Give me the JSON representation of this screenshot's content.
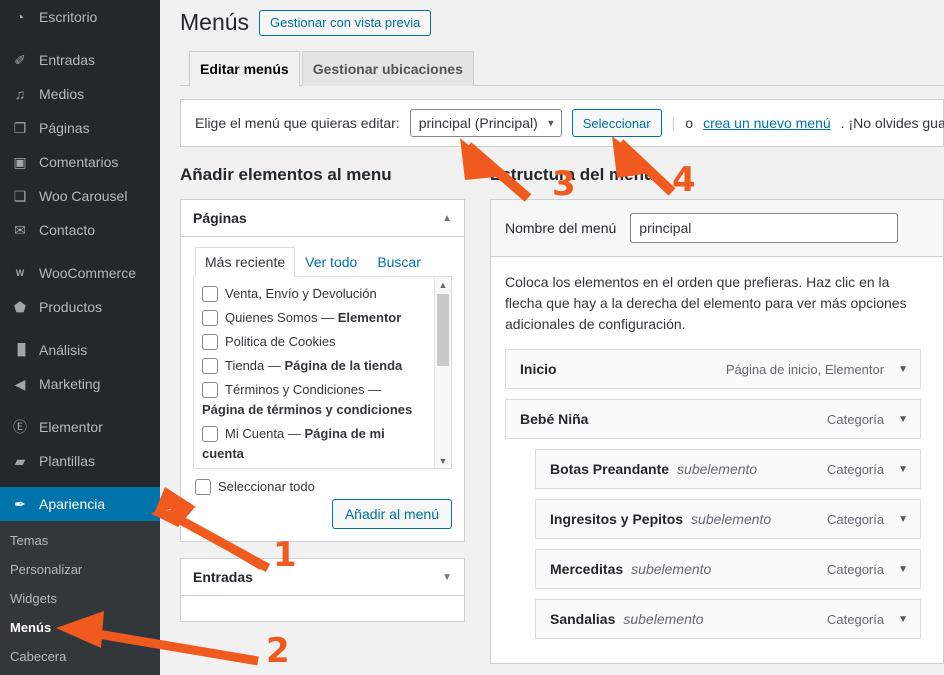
{
  "sidebar": {
    "items": [
      {
        "label": "Escritorio",
        "icon": "dashboard-icon",
        "current": false
      },
      {
        "label": "Entradas",
        "icon": "pin-icon",
        "current": false
      },
      {
        "label": "Medios",
        "icon": "media-icon",
        "current": false
      },
      {
        "label": "Páginas",
        "icon": "pages-icon",
        "current": false
      },
      {
        "label": "Comentarios",
        "icon": "comments-icon",
        "current": false
      },
      {
        "label": "Woo Carousel",
        "icon": "gallery-icon",
        "current": false
      },
      {
        "label": "Contacto",
        "icon": "envelope-icon",
        "current": false
      },
      {
        "label": "WooCommerce",
        "icon": "woo-icon",
        "current": false
      },
      {
        "label": "Productos",
        "icon": "box-icon",
        "current": false
      },
      {
        "label": "Análisis",
        "icon": "chart-bars-icon",
        "current": false
      },
      {
        "label": "Marketing",
        "icon": "megaphone-icon",
        "current": false
      },
      {
        "label": "Elementor",
        "icon": "elementor-icon",
        "current": false
      },
      {
        "label": "Plantillas",
        "icon": "folder-icon",
        "current": false
      },
      {
        "label": "Apariencia",
        "icon": "brush-icon",
        "current": true
      }
    ],
    "submenu": [
      {
        "label": "Temas",
        "active": false
      },
      {
        "label": "Personalizar",
        "active": false
      },
      {
        "label": "Widgets",
        "active": false
      },
      {
        "label": "Menús",
        "active": true
      },
      {
        "label": "Cabecera",
        "active": false
      }
    ]
  },
  "header": {
    "title": "Menús",
    "preview_button": "Gestionar con vista previa",
    "tabs": [
      {
        "label": "Editar menús",
        "active": true
      },
      {
        "label": "Gestionar ubicaciones",
        "active": false
      }
    ]
  },
  "chooser": {
    "label": "Elige el menú que quieras editar:",
    "selected_menu": "principal (Principal)",
    "select_button": "Seleccionar",
    "or_text": "o",
    "create_link": "crea un nuevo menú",
    "tail_text": ". ¡No olvides guardar tus cambios!"
  },
  "add_items": {
    "heading": "Añadir elementos al menu",
    "panels": [
      {
        "title": "Páginas",
        "collapsed": false,
        "toggle_icon": "chevron-up-icon"
      },
      {
        "title": "Entradas",
        "collapsed": true,
        "toggle_icon": "chevron-down-icon"
      }
    ],
    "inner_tabs": [
      {
        "label": "Más reciente",
        "selected": true
      },
      {
        "label": "Ver todo",
        "selected": false
      },
      {
        "label": "Buscar",
        "selected": false
      }
    ],
    "pages": [
      {
        "name": "Venta, Envío y Devolución",
        "suffix": ""
      },
      {
        "name": "Quienes Somos — ",
        "suffix": "Elementor"
      },
      {
        "name": "Politica de Cookies",
        "suffix": ""
      },
      {
        "name": "Tienda — ",
        "suffix": "Página de la tienda"
      },
      {
        "name": "Términos y Condiciones — ",
        "suffix": ""
      },
      {
        "name": "Mi Cuenta — ",
        "suffix": "Página de mi"
      }
    ],
    "wrapped_line_1": "Página de términos y condiciones",
    "wrapped_line_2": "cuenta",
    "select_all_label": "Seleccionar todo",
    "add_button": "Añadir al menú"
  },
  "structure": {
    "heading": "Estructura del menú",
    "name_label": "Nombre del menú",
    "name_value": "principal",
    "instructions": "Coloca los elementos en el orden que prefieras. Haz clic en la flecha que hay a la derecha del elemento para ver más opciones adicionales de configuración.",
    "items": [
      {
        "title": "Inicio",
        "sub": "",
        "type": "Página de inicio, Elementor",
        "depth": 0
      },
      {
        "title": "Bebé Niña",
        "sub": "",
        "type": "Categoría",
        "depth": 0
      },
      {
        "title": "Botas Preandante",
        "sub": "subelemento",
        "type": "Categoría",
        "depth": 1
      },
      {
        "title": "Ingresitos y Pepitos",
        "sub": "subelemento",
        "type": "Categoría",
        "depth": 1
      },
      {
        "title": "Merceditas",
        "sub": "subelemento",
        "type": "Categoría",
        "depth": 1
      },
      {
        "title": "Sandalias",
        "sub": "subelemento",
        "type": "Categoría",
        "depth": 1
      }
    ]
  },
  "annotations": {
    "color": "#f05a1e",
    "steps": [
      {
        "number": "1",
        "target": "sidebar-item-apariencia"
      },
      {
        "number": "2",
        "target": "sidebar-subitem-menus"
      },
      {
        "number": "3",
        "target": "menu-select-dropdown"
      },
      {
        "number": "4",
        "target": "select-menu-button"
      }
    ]
  }
}
